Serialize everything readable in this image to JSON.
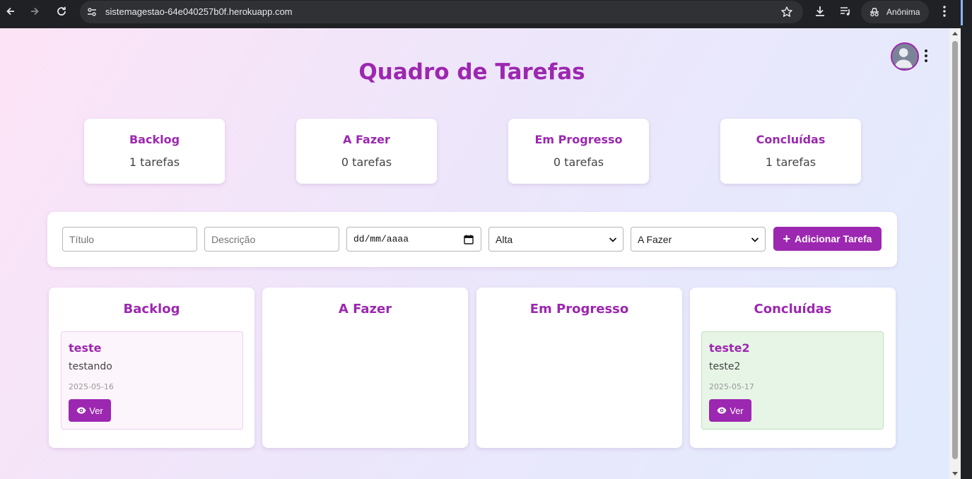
{
  "browser": {
    "url": "sistemagestao-64e040257b0f.herokuapp.com",
    "profile_label": "Anônima"
  },
  "page": {
    "title": "Quadro de Tarefas"
  },
  "stats": [
    {
      "name": "Backlog",
      "count": "1 tarefas"
    },
    {
      "name": "A Fazer",
      "count": "0 tarefas"
    },
    {
      "name": "Em Progresso",
      "count": "0 tarefas"
    },
    {
      "name": "Concluídas",
      "count": "1 tarefas"
    }
  ],
  "form": {
    "title_placeholder": "Título",
    "description_placeholder": "Descrição",
    "date_placeholder": "dd/mm/aaaa",
    "priority_selected": "Alta",
    "status_selected": "A Fazer",
    "add_button_label": "Adicionar Tarefa"
  },
  "columns": [
    {
      "title": "Backlog",
      "tasks": [
        {
          "title": "teste",
          "description": "testando",
          "date": "2025-05-16",
          "view_label": "Ver"
        }
      ]
    },
    {
      "title": "A Fazer",
      "tasks": []
    },
    {
      "title": "Em Progresso",
      "tasks": []
    },
    {
      "title": "Concluídas",
      "tasks": [
        {
          "title": "teste2",
          "description": "teste2",
          "date": "2025-05-17",
          "view_label": "Ver"
        }
      ]
    }
  ],
  "colors": {
    "accent": "#9c27b0",
    "backlog_card_bg": "#fdf5fc",
    "done_card_bg": "#e7f5e6"
  },
  "icons": [
    "back-arrow-icon",
    "forward-arrow-icon",
    "reload-icon",
    "site-settings-icon",
    "star-icon",
    "download-icon",
    "media-queue-icon",
    "incognito-icon",
    "chrome-menu-icon",
    "avatar",
    "kebab-menu-icon",
    "calendar-icon",
    "chevron-down-icon",
    "plus-icon",
    "eye-icon"
  ]
}
